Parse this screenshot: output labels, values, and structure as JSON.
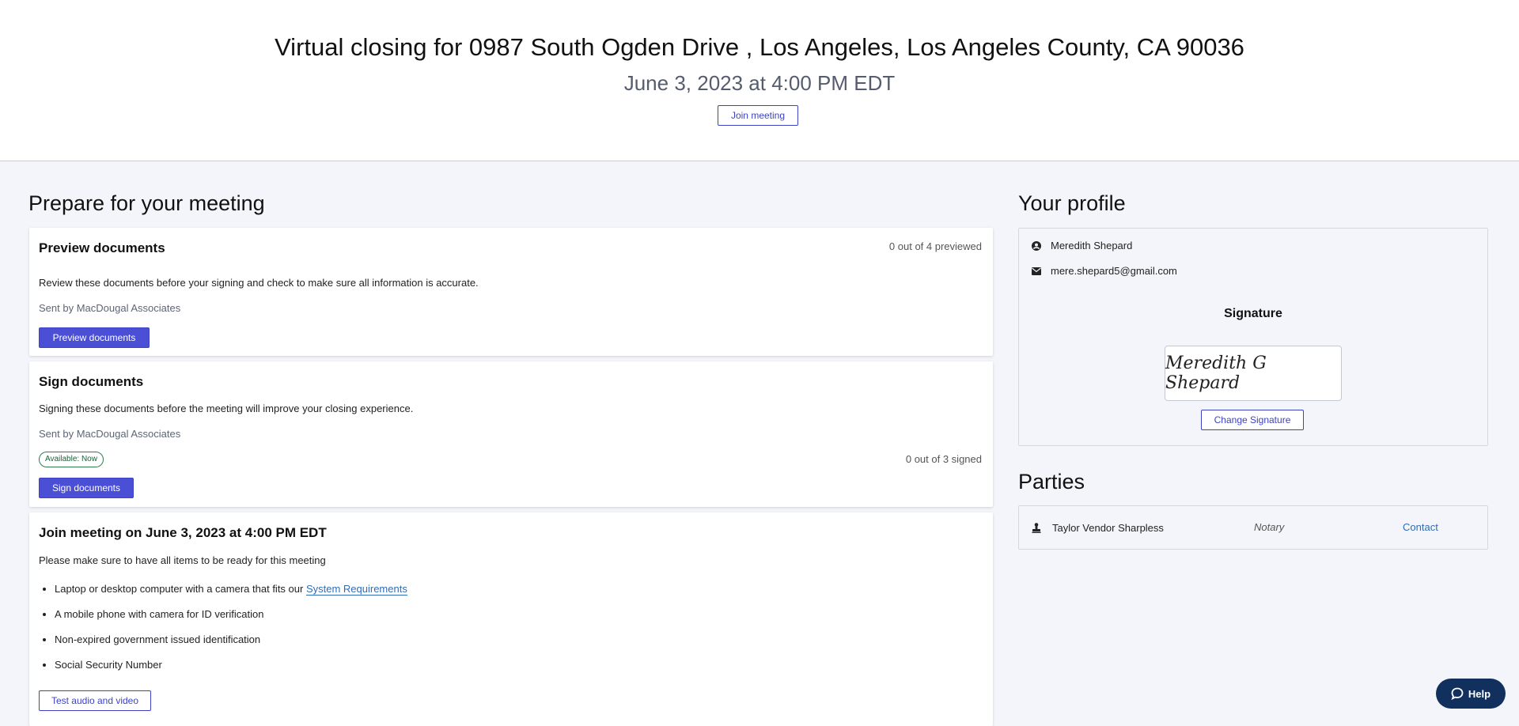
{
  "header": {
    "title": "Virtual closing for 0987 South Ogden Drive , Los Angeles, Los Angeles County, CA 90036",
    "datetime": "June 3, 2023 at 4:00 PM EDT",
    "join_label": "Join meeting"
  },
  "prepare": {
    "heading": "Prepare for your meeting",
    "preview": {
      "title": "Preview documents",
      "count": "0 out of 4 previewed",
      "description": "Review these documents before your signing and check to make sure all information is accurate.",
      "sender": "Sent by MacDougal Associates",
      "button": "Preview documents"
    },
    "sign": {
      "title": "Sign documents",
      "description": "Signing these documents before the meeting will improve your closing experience.",
      "sender": "Sent by MacDougal Associates",
      "badge": "Available: Now",
      "count": "0 out of 3 signed",
      "button": "Sign documents"
    },
    "join": {
      "title": "Join meeting on June 3, 2023 at 4:00 PM EDT",
      "intro": "Please make sure to have all items to be ready for this meeting",
      "item1_text": "Laptop or desktop computer with a camera that fits our ",
      "item1_link": "System Requirements",
      "item2": "A mobile phone with camera for ID verification",
      "item3": "Non-expired government issued identification",
      "item4": "Social Security Number",
      "button": "Test audio and video"
    }
  },
  "profile": {
    "heading": "Your profile",
    "name": "Meredith Shepard",
    "email": "mere.shepard5@gmail.com",
    "signature_heading": "Signature",
    "signature_text": "Meredith G Shepard",
    "change_signature": "Change Signature"
  },
  "parties": {
    "heading": "Parties",
    "rows": [
      {
        "name": "Taylor Vendor Sharpless",
        "role": "Notary",
        "action": "Contact"
      }
    ]
  },
  "help": {
    "label": "Help"
  },
  "colors": {
    "accent": "#4a4fd6",
    "link": "#2f6cb7",
    "badge": "#2e7d4f",
    "help_bg": "#12305e"
  }
}
